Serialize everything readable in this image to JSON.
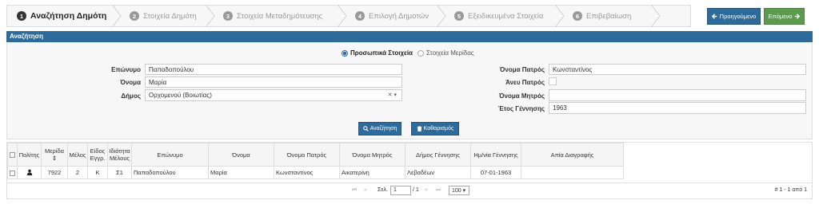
{
  "wizard": {
    "steps": [
      {
        "num": "1",
        "label": "Αναζήτηση Δημότη"
      },
      {
        "num": "2",
        "label": "Στοιχεία Δημότη"
      },
      {
        "num": "3",
        "label": "Στοιχεία Μεταδημότευσης"
      },
      {
        "num": "4",
        "label": "Επιλογή Δημοτών"
      },
      {
        "num": "5",
        "label": "Εξειδικευμένα Στοιχεία"
      },
      {
        "num": "6",
        "label": "Επιβεβαίωση"
      }
    ],
    "prev_label": "Προηγούμενο",
    "next_label": "Επόμενο"
  },
  "search": {
    "title": "Αναζήτηση",
    "radio_personal": "Προσωπικά Στοιχεία",
    "radio_share": "Στοιχεία Μερίδας",
    "surname_label": "Επώνυμο",
    "surname_value": "Παπαδοπούλου",
    "name_label": "Όνομα",
    "name_value": "Μαρία",
    "municipality_label": "Δήμος",
    "municipality_value": "Ορχομενού (Βοιωτίας)",
    "father_label": "Όνομα Πατρός",
    "father_value": "Κωνσταντίνος",
    "no_father_label": "Άνευ Πατρός",
    "mother_label": "Όνομα Μητρός",
    "mother_value": "",
    "birthyear_label": "Έτος Γέννησης",
    "birthyear_value": "1963",
    "search_button": "Αναζήτηση",
    "clear_button": "Καθαρισμός"
  },
  "grid": {
    "headers": [
      "Πολίτης",
      "Μερίδα",
      "Μέλος",
      "Είδος Εγγρ.",
      "Ιδιότητα Μέλους",
      "Επώνυμο",
      "Όνομα",
      "Όνομα Πατρός",
      "Όνομα Μητρός",
      "Δήμος Γέννησης",
      "Ημ/νία Γέννησης",
      "Απία Διαγραφής"
    ],
    "rows": [
      {
        "share": "7922",
        "member": "2",
        "type": "Κ",
        "role": "Σ1",
        "surname": "Παπαδοπούλου",
        "name": "Μαρία",
        "father": "Κωνσταντίνος",
        "mother": "Αικατερίνη",
        "birthplace": "Λεβαδέων",
        "birthdate": "07-01-1963",
        "deletion": ""
      }
    ],
    "page_label": "Σελ.",
    "page_value": "1",
    "page_total": "/ 1",
    "page_size": "100",
    "record_info": "# 1 - 1 από 1"
  },
  "colors": {
    "primary": "#2f6b9a",
    "success": "#5c9a4e",
    "header_bg": "#f5f5f5"
  }
}
